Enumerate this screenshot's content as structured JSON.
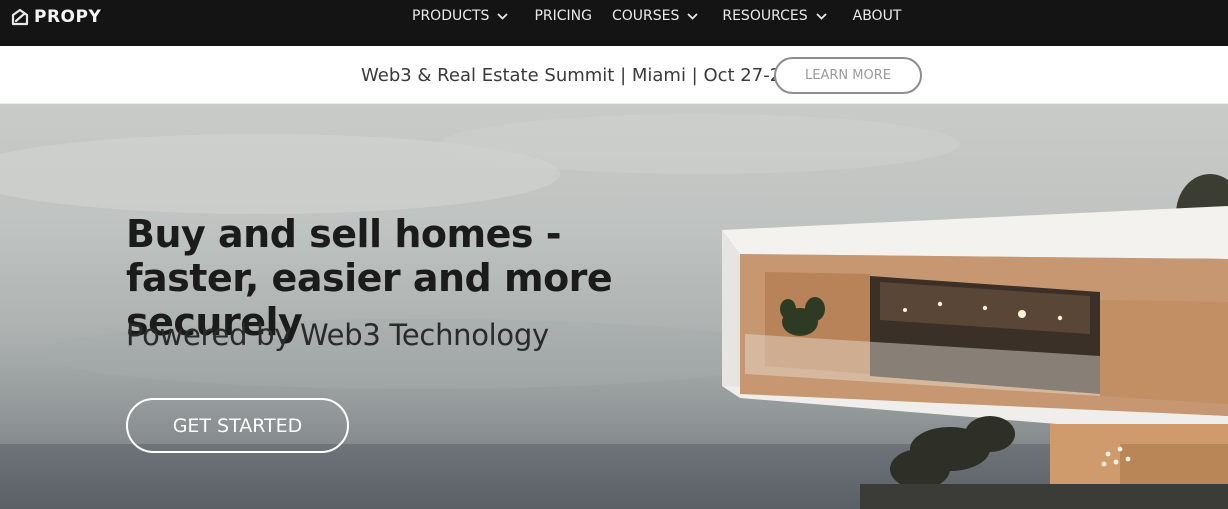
{
  "brand": {
    "name": "PROPY",
    "icon": "propy-logo-icon"
  },
  "nav": {
    "items": [
      {
        "label": "PRODUCTS",
        "has_dropdown": true
      },
      {
        "label": "PRICING",
        "has_dropdown": false
      },
      {
        "label": "COURSES",
        "has_dropdown": true
      },
      {
        "label": "RESOURCES",
        "has_dropdown": true
      },
      {
        "label": "ABOUT",
        "has_dropdown": false
      }
    ]
  },
  "announcement": {
    "text": "Web3 & Real Estate Summit | Miami | Oct 27-28",
    "button_label": "LEARN MORE"
  },
  "hero": {
    "headline": "Buy and sell homes - faster, easier and more securely",
    "subheadline": "Powered by Web3 Technology",
    "cta_label": "GET STARTED"
  },
  "colors": {
    "nav_bg": "#141414",
    "nav_text": "#e9e9e9",
    "announce_bg": "#ffffff",
    "accent_outline": "#8d8d8d"
  }
}
